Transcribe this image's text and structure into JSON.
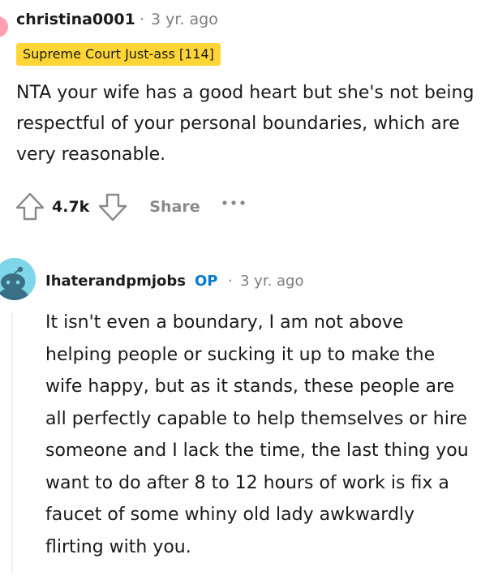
{
  "comments": [
    {
      "author": "christina0001",
      "separator": "·",
      "time": "3 yr. ago",
      "flair": "Supreme Court Just-ass [114]",
      "body": "NTA your wife has a good heart but she's not being respectful of your personal boundaries, which are very reasonable.",
      "score": "4.7k",
      "share_label": "Share",
      "more_label": "•••",
      "flair_color": "#ffd635"
    },
    {
      "author": "Ihaterandpmjobs",
      "op_badge": "OP",
      "separator": "·",
      "time": "3 yr. ago",
      "body": "It isn't even a boundary, I am not above helping people or sucking it up to make the wife happy, but as it stands, these people are all perfectly capable to help themselves or hire someone and I lack the time, the last thing you want to do after 8 to 12 hours of work is fix a faucet of some whiny old lady awkwardly flirting with you.",
      "op_color": "#0079d3"
    }
  ]
}
